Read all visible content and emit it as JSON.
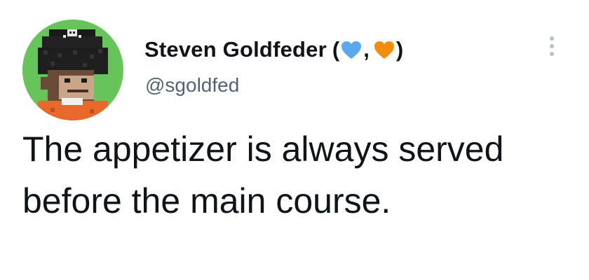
{
  "tweet": {
    "author": {
      "display_name": "Steven Goldfeder",
      "name_open_paren": "(",
      "name_separator": ",",
      "name_close_paren": ")",
      "heart_1_color": "#5ba7f0",
      "heart_2_color": "#f18c0e",
      "handle": "@sgoldfed",
      "avatar_icon": "pixel-art-pirate-monkey-avatar",
      "avatar_bg_color": "#66c45a"
    },
    "more_icon": "vertical-ellipsis-icon",
    "text": "The appetizer is always served before the main course."
  }
}
